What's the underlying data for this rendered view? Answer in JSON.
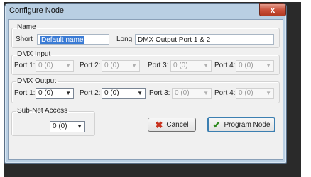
{
  "window": {
    "title": "Configure Node",
    "close_label": "x"
  },
  "name_group": {
    "legend": "Name",
    "short_label": "Short",
    "short_value": "Default name",
    "long_label": "Long",
    "long_value": "DMX Output Port 1 & 2"
  },
  "dmx_input": {
    "legend": "DMX Input",
    "ports": [
      {
        "label": "Port 1:",
        "value": "0 (0)"
      },
      {
        "label": "Port 2:",
        "value": "0 (0)"
      },
      {
        "label": "Port 3:",
        "value": "0 (0)"
      },
      {
        "label": "Port 4:",
        "value": "0 (0)"
      }
    ]
  },
  "dmx_output": {
    "legend": "DMX Output",
    "ports": [
      {
        "label": "Port 1:",
        "value": "0 (0)"
      },
      {
        "label": "Port 2:",
        "value": "0 (0)"
      },
      {
        "label": "Port 3:",
        "value": "0 (0)"
      },
      {
        "label": "Port 4:",
        "value": "0 (0)"
      }
    ]
  },
  "subnet": {
    "legend": "Sub-Net Access",
    "value": "0 (0)"
  },
  "buttons": {
    "cancel": "Cancel",
    "program": "Program Node"
  },
  "icons": {
    "cancel": "x-mark-icon",
    "program": "check-mark-icon",
    "dropdown": "chevron-down-icon"
  }
}
